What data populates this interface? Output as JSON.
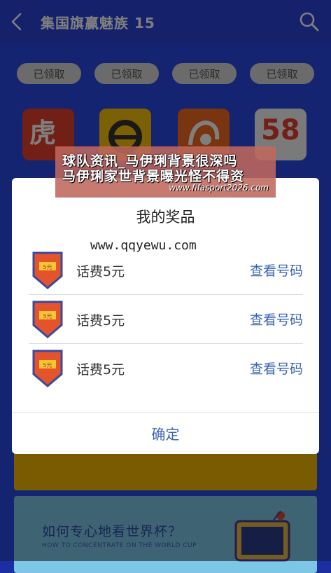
{
  "header": {
    "title": "集国旗赢魅族 15",
    "back_icon": "chevron-left-icon",
    "search_icon": "search-icon",
    "bar_color": "#2b43d6"
  },
  "background_page": {
    "claim_buttons": [
      "已领取",
      "已领取",
      "已领取",
      "已领取"
    ],
    "app_icons": [
      "huya-icon",
      "didi-icon",
      "uc-browser-icon",
      "58-icon"
    ],
    "app_badge_text": [
      "虎",
      "58"
    ],
    "banner": {
      "title": "如何专心地看世界杯？",
      "subtitle": "HOW TO CONCENTRATE ON THE WORLD CUP"
    }
  },
  "modal": {
    "title": "我的奖品",
    "watermark": "www.qqyewu.com",
    "prizes": [
      {
        "name": "话费5元",
        "action": "查看号码",
        "badge_text": "5元"
      },
      {
        "name": "话费5元",
        "action": "查看号码",
        "badge_text": "5元"
      },
      {
        "name": "话费5元",
        "action": "查看号码",
        "badge_text": "5元"
      }
    ],
    "confirm_label": "确定",
    "link_color": "#3a64b5"
  },
  "overlay_ad": {
    "line1": "球队资讯_马伊琍背景很深吗",
    "line2": "马伊琍家世背景曝光怪不得资",
    "url": "www.fifasport2026.com"
  }
}
